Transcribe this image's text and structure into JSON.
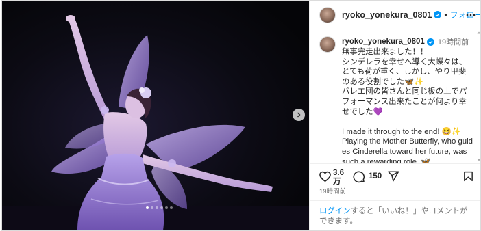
{
  "post": {
    "username": "ryoko_yonekura_0801",
    "follow_label": "フォローする",
    "separator": "•",
    "caption_time": "19時間前",
    "caption": "無事完走出来ました！！\nシンデレラを幸せへ導く大蝶々は、とても荷が重く、しかし、やり甲斐のある役割でした🦋✨\nバレエ団の皆さんと同じ板の上でパフォーマンス出来たことが何より幸せでした💜\n\nI made it through to the end! 😆✨\nPlaying the Mother Butterfly, who guides Cinderella toward her future, was such a rewarding role. 🦋\nSharing the stage with all of you was",
    "likes_count": "3.6万",
    "comments_count": "150",
    "post_time": "19時間前"
  },
  "login_prompt": {
    "link": "ログイン",
    "text": "すると「いいね！」やコメントができます。"
  },
  "carousel": {
    "total": 6,
    "active": 0
  },
  "icons": {
    "verified": "verified-badge-icon",
    "more": "more-options-icon",
    "next": "chevron-right-icon",
    "like": "heart-icon",
    "comment": "comment-bubble-icon",
    "share": "paper-plane-icon",
    "save": "bookmark-icon"
  },
  "colors": {
    "link_blue": "#0095f6",
    "verified_blue": "#0095f6",
    "text": "#262626",
    "muted": "#737373",
    "stage_purple": "#9b7fd6"
  }
}
